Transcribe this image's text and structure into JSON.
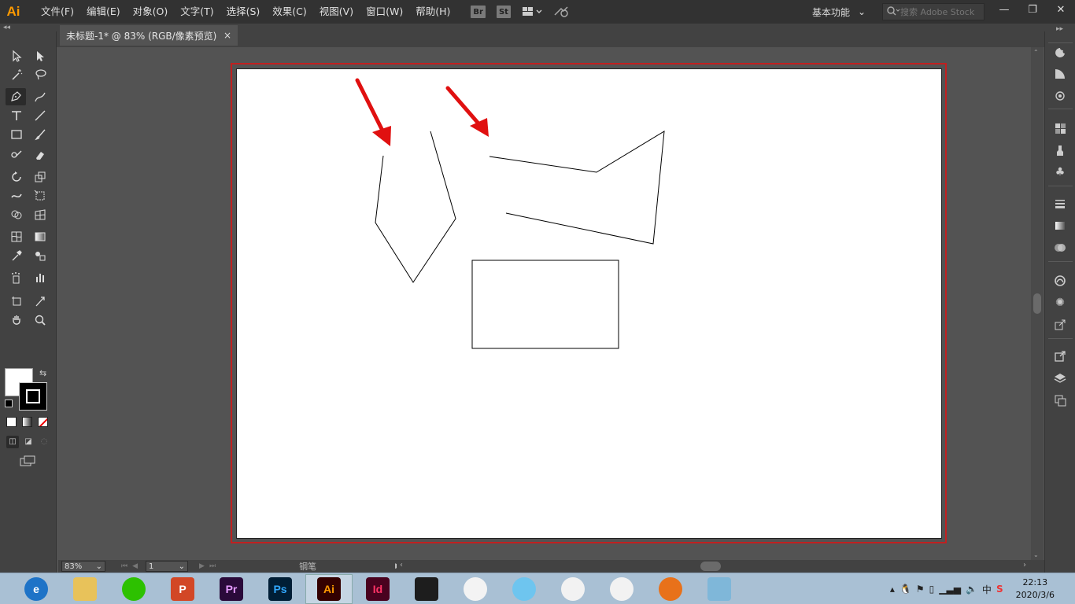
{
  "app": {
    "logo": "Ai"
  },
  "menus": [
    "文件(F)",
    "编辑(E)",
    "对象(O)",
    "文字(T)",
    "选择(S)",
    "效果(C)",
    "视图(V)",
    "窗口(W)",
    "帮助(H)"
  ],
  "bridge": {
    "br": "Br",
    "st": "St"
  },
  "workspace": {
    "label": "基本功能",
    "chevron": "⌄"
  },
  "search": {
    "placeholder": "搜索 Adobe Stock"
  },
  "window_controls": {
    "minimize": "—",
    "restore": "❐",
    "close": "✕"
  },
  "document_tab": {
    "title": "未标题-1* @ 83% (RGB/像素预览)",
    "close": "×"
  },
  "status": {
    "zoom": "83%",
    "page": "1",
    "tool": "钢笔"
  },
  "clock": {
    "time": "22:13",
    "date": "2020/3/6"
  },
  "taskbar_apps": [
    {
      "name": "ie",
      "label": "e",
      "bg": "#1e73c7",
      "fg": "#fff",
      "active": false
    },
    {
      "name": "explorer",
      "label": "",
      "bg": "#e8c25a",
      "fg": "#fff",
      "active": false
    },
    {
      "name": "wechat",
      "label": "",
      "bg": "#2dc100",
      "fg": "#fff",
      "active": false
    },
    {
      "name": "powerpoint",
      "label": "P",
      "bg": "#d24726",
      "fg": "#fff",
      "active": false
    },
    {
      "name": "premiere",
      "label": "Pr",
      "bg": "#2a0a3a",
      "fg": "#e59bff",
      "active": false
    },
    {
      "name": "photoshop",
      "label": "Ps",
      "bg": "#001e36",
      "fg": "#31a8ff",
      "active": false
    },
    {
      "name": "illustrator",
      "label": "Ai",
      "bg": "#330000",
      "fg": "#ff9a00",
      "active": true
    },
    {
      "name": "indesign",
      "label": "Id",
      "bg": "#49021f",
      "fg": "#ff3366",
      "active": false
    },
    {
      "name": "video",
      "label": "",
      "bg": "#1d1d1d",
      "fg": "#fff",
      "active": false
    },
    {
      "name": "umbrella",
      "label": "",
      "bg": "#f3f3f3",
      "fg": "#e22",
      "active": false
    },
    {
      "name": "cloud-app",
      "label": "",
      "bg": "#6ec5ef",
      "fg": "#fff",
      "active": false
    },
    {
      "name": "qq",
      "label": "",
      "bg": "#f2f2f2",
      "fg": "#000",
      "active": false
    },
    {
      "name": "chrome",
      "label": "",
      "bg": "#f2f2f2",
      "fg": "#000",
      "active": false
    },
    {
      "name": "fox-app",
      "label": "",
      "bg": "#e8711a",
      "fg": "#fff",
      "active": false
    },
    {
      "name": "notebook",
      "label": "",
      "bg": "#7fb7d9",
      "fg": "#fff",
      "active": false
    }
  ],
  "colors": {
    "accent": "#ff9a00",
    "artboard_outline": "#c02020",
    "arrow": "#e01010"
  }
}
